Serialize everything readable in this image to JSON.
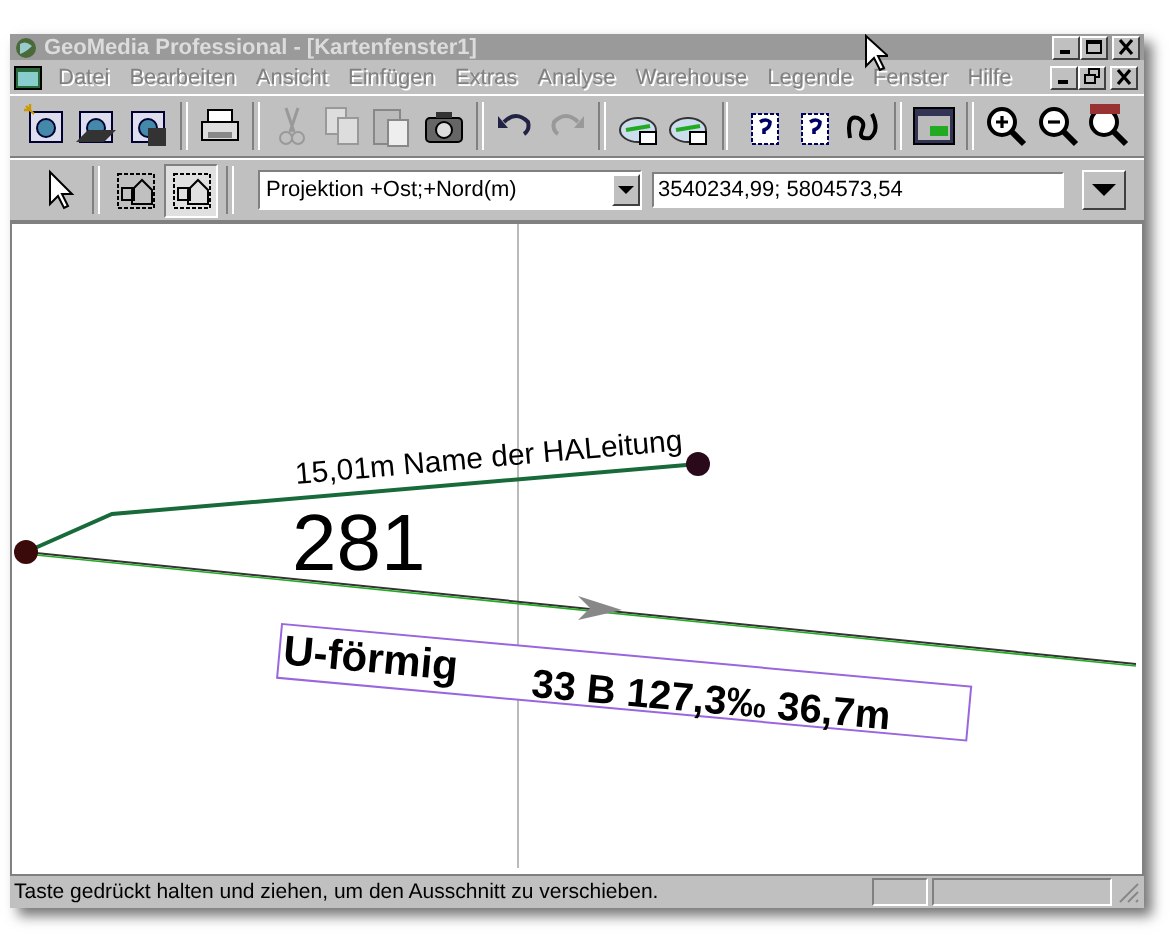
{
  "window": {
    "title": "GeoMedia Professional - [Kartenfenster1]",
    "active": false
  },
  "menu": [
    {
      "label": "Datei",
      "disabled": true
    },
    {
      "label": "Bearbeiten",
      "disabled": true
    },
    {
      "label": "Ansicht",
      "disabled": true
    },
    {
      "label": "Einfügen",
      "disabled": true
    },
    {
      "label": "Extras",
      "disabled": true
    },
    {
      "label": "Analyse",
      "disabled": true
    },
    {
      "label": "Warehouse",
      "disabled": true
    },
    {
      "label": "Legende",
      "disabled": true
    },
    {
      "label": "Fenster",
      "disabled": true
    },
    {
      "label": "Hilfe",
      "disabled": true
    }
  ],
  "select_tools": [
    {
      "selected": false
    },
    {
      "selected": false
    },
    {
      "selected": true
    }
  ],
  "coordinate_system": {
    "value": "Projektion +Ost;+Nord(m)"
  },
  "coordinates": {
    "value": "3540234,99; 5804573,54"
  },
  "map": {
    "line_label": "15,01m Name der HALeitung",
    "number_label": "281",
    "box_labels": [
      "U-förmig",
      "33 B 127,3‰ 36,7m"
    ]
  },
  "status_bar": "Taste gedrückt halten und ziehen, um den Ausschnitt zu verschieben."
}
